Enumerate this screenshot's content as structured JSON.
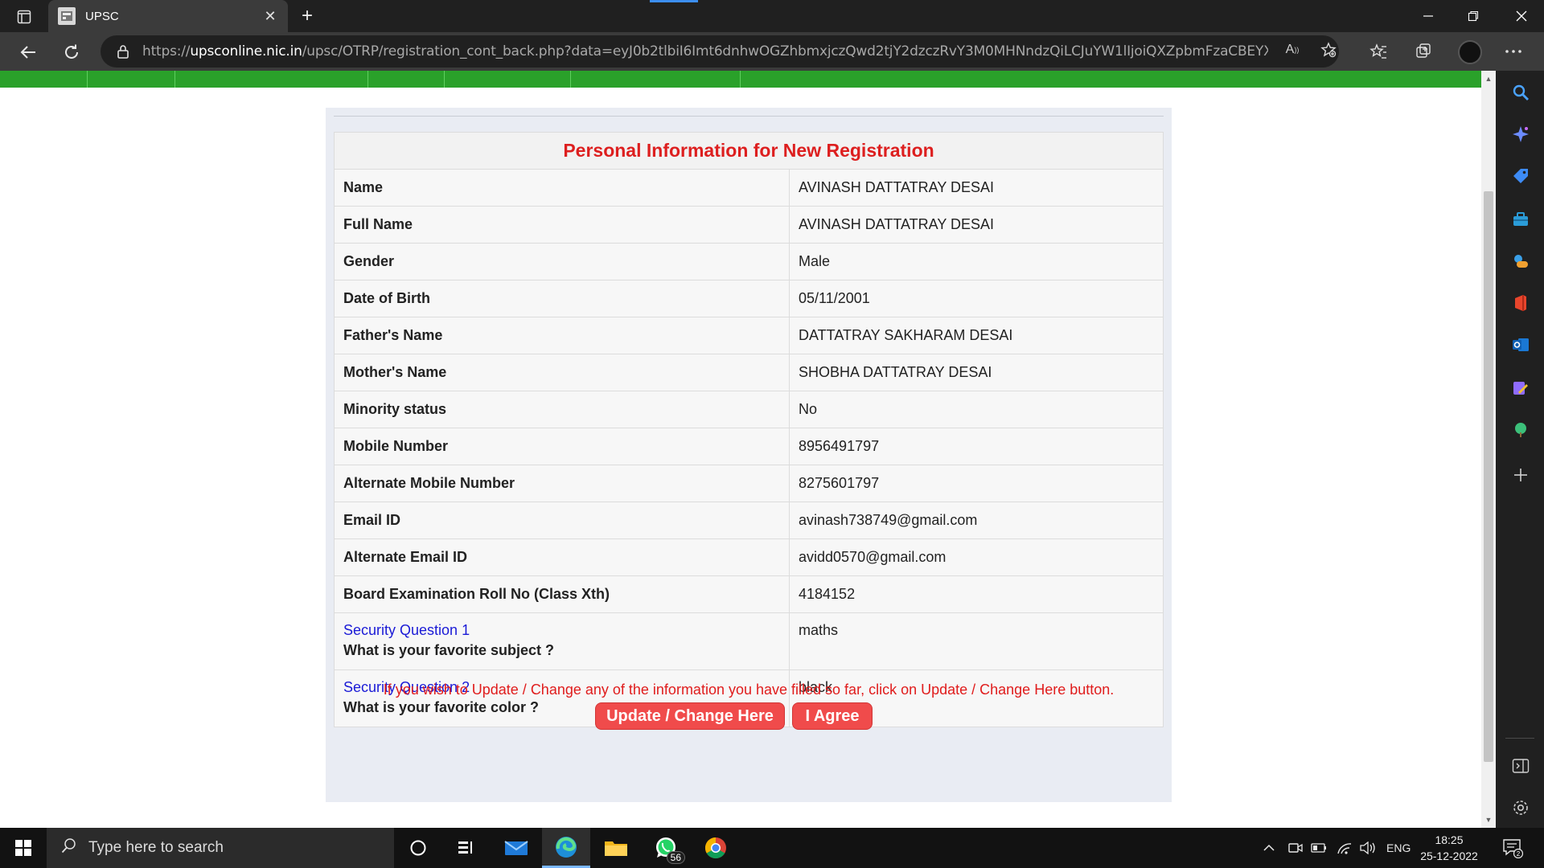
{
  "browser": {
    "tab_title": "UPSC",
    "url_prefix": "https://",
    "url_host": "upsconline.nic.in",
    "url_path": "/upsc/OTRP/registration_cont_back.php?data=eyJ0b2tlbiI6Imt6dnhwOGZhbmxjczQwd2tjY2dzczRvY3M0MHNndzQiLCJuYW1lIjoiQXZpbmFzaCBEYXR0YXRyY..."
  },
  "form": {
    "heading": "Personal Information for New Registration",
    "rows": [
      {
        "label": "Name",
        "value": "AVINASH DATTATRAY DESAI"
      },
      {
        "label": "Full Name",
        "value": "AVINASH DATTATRAY DESAI"
      },
      {
        "label": "Gender",
        "value": "Male"
      },
      {
        "label": "Date of Birth",
        "value": "05/11/2001"
      },
      {
        "label": "Father's Name",
        "value": "DATTATRAY SAKHARAM DESAI"
      },
      {
        "label": "Mother's Name",
        "value": "SHOBHA DATTATRAY DESAI"
      },
      {
        "label": "Minority status",
        "value": "No"
      },
      {
        "label": "Mobile Number",
        "value": "8956491797"
      },
      {
        "label": "Alternate Mobile Number",
        "value": "8275601797"
      },
      {
        "label": "Email ID",
        "value": "avinash738749@gmail.com"
      },
      {
        "label": "Alternate Email ID",
        "value": "avidd0570@gmail.com"
      },
      {
        "label": "Board Examination Roll No (Class Xth)",
        "value": "4184152"
      }
    ],
    "security_questions": [
      {
        "title": "Security Question 1",
        "question": "What is your favorite subject ?",
        "answer": "maths"
      },
      {
        "title": "Security Question 2",
        "question": "What is your favorite color ?",
        "answer": "black"
      }
    ],
    "notice": "If you wish to Update / Change any of the information you have filled so far, click on Update / Change Here button.",
    "update_button": "Update / Change Here",
    "agree_button": "I Agree"
  },
  "taskbar": {
    "search_placeholder": "Type here to search",
    "whatsapp_badge": "56",
    "language": "ENG",
    "time": "18:25",
    "date": "25-12-2022",
    "notification_count": "2"
  },
  "colors": {
    "heading_red": "#dd1f1f",
    "button_red": "#f04b4b",
    "link_blue": "#1a1ad6",
    "nav_green": "#2aa12a"
  }
}
